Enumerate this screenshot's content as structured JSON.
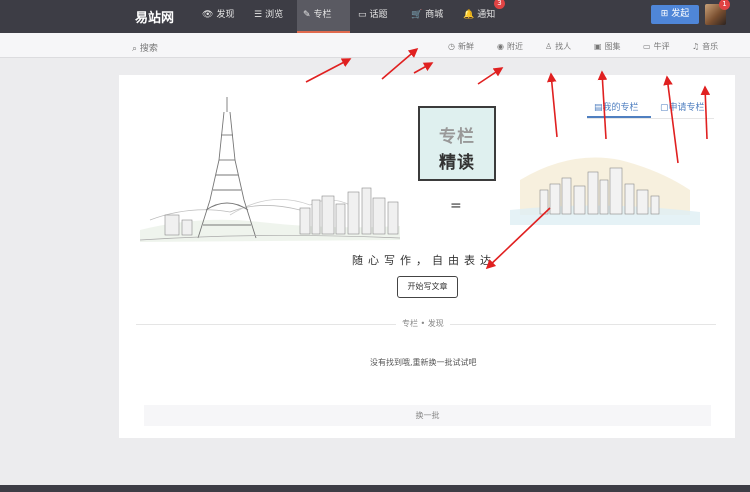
{
  "topbar": {
    "logo": "易站网",
    "nav": [
      {
        "label": "发现",
        "icon": "eye-icon"
      },
      {
        "label": "浏览",
        "icon": "list-icon"
      },
      {
        "label": "专栏",
        "icon": "pen-icon"
      },
      {
        "label": "话题",
        "icon": "chat-icon"
      },
      {
        "label": "商城",
        "icon": "cart-icon"
      },
      {
        "label": "通知",
        "icon": "bell-icon",
        "badge": "3"
      }
    ],
    "active_index": 2,
    "post_button": "发起",
    "avatar_badge": "1"
  },
  "subbar": {
    "search_label": "搜索",
    "items": [
      {
        "label": "新鲜",
        "icon": "clock-icon"
      },
      {
        "label": "附近",
        "icon": "location-icon"
      },
      {
        "label": "找人",
        "icon": "people-icon"
      },
      {
        "label": "图集",
        "icon": "image-icon"
      },
      {
        "label": "牛评",
        "icon": "comment-icon"
      },
      {
        "label": "音乐",
        "icon": "headphones-icon"
      }
    ]
  },
  "column": {
    "tabs": {
      "mine": "我的专栏",
      "apply": "申请专栏"
    },
    "badge_line1": "专栏",
    "badge_line2": "精读",
    "slogan": "随心写作，自由表达",
    "start_button": "开始写文章",
    "section_label": "专栏 • 发现",
    "empty_message": "没有找到哦,重新换一批试试吧",
    "refresh_button": "换一批"
  },
  "colors": {
    "topbar": "#3d3d45",
    "accent_blue": "#4f86d8",
    "annotation_red": "#e02020",
    "badge_red": "#e04444"
  }
}
